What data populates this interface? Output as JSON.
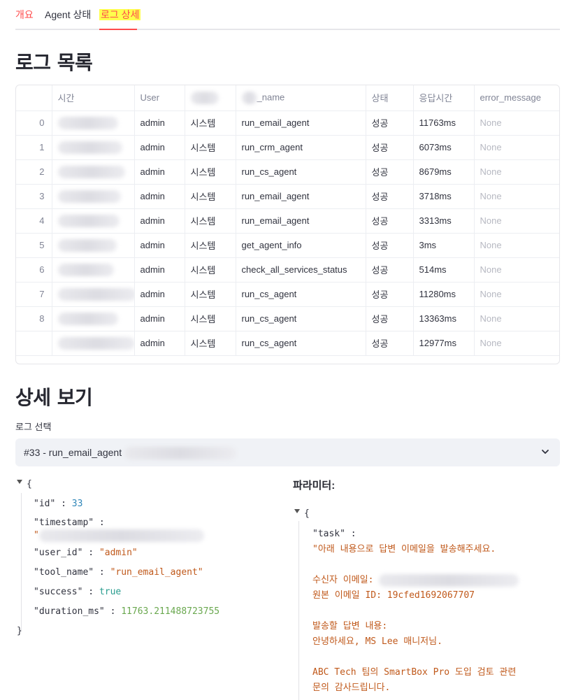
{
  "tabs": [
    {
      "label": "개요"
    },
    {
      "label": "Agent 상태"
    },
    {
      "label": "로그 상세"
    }
  ],
  "log_list": {
    "title": "로그 목록",
    "columns": [
      "",
      "시간",
      "User",
      "",
      "_name",
      "상태",
      "응답시간",
      "error_message"
    ],
    "rows": [
      {
        "idx": "0",
        "user": "admin",
        "type": "시스템",
        "tool": "run_email_agent",
        "status": "성공",
        "duration": "11763ms",
        "error": "None"
      },
      {
        "idx": "1",
        "user": "admin",
        "type": "시스템",
        "tool": "run_crm_agent",
        "status": "성공",
        "duration": "6073ms",
        "error": "None"
      },
      {
        "idx": "2",
        "user": "admin",
        "type": "시스템",
        "tool": "run_cs_agent",
        "status": "성공",
        "duration": "8679ms",
        "error": "None"
      },
      {
        "idx": "3",
        "user": "admin",
        "type": "시스템",
        "tool": "run_email_agent",
        "status": "성공",
        "duration": "3718ms",
        "error": "None"
      },
      {
        "idx": "4",
        "user": "admin",
        "type": "시스템",
        "tool": "run_email_agent",
        "status": "성공",
        "duration": "3313ms",
        "error": "None"
      },
      {
        "idx": "5",
        "user": "admin",
        "type": "시스템",
        "tool": "get_agent_info",
        "status": "성공",
        "duration": "3ms",
        "error": "None"
      },
      {
        "idx": "6",
        "user": "admin",
        "type": "시스템",
        "tool": "check_all_services_status",
        "status": "성공",
        "duration": "514ms",
        "error": "None"
      },
      {
        "idx": "7",
        "user": "admin",
        "type": "시스템",
        "tool": "run_cs_agent",
        "status": "성공",
        "duration": "11280ms",
        "error": "None"
      },
      {
        "idx": "8",
        "user": "admin",
        "type": "시스템",
        "tool": "run_cs_agent",
        "status": "성공",
        "duration": "13363ms",
        "error": "None"
      },
      {
        "idx": "",
        "user": "admin",
        "type": "시스템",
        "tool": "run_cs_agent",
        "status": "성공",
        "duration": "12977ms",
        "error": "None"
      }
    ]
  },
  "detail": {
    "title": "상세 보기",
    "select_label": "로그 선택",
    "select_value": "#33 - run_email_agent"
  },
  "json_view": {
    "open": "{",
    "close": "}",
    "id_key": "\"id\"",
    "id_val": "33",
    "ts_key": "\"timestamp\"",
    "ts_val": "\"",
    "user_key": "\"user_id\"",
    "user_val": "\"admin\"",
    "tool_key": "\"tool_name\"",
    "tool_val": "\"run_email_agent\"",
    "success_key": "\"success\"",
    "success_val": "true",
    "dur_key": "\"duration_ms\"",
    "dur_val": "11763.211488723755"
  },
  "params": {
    "title": "파라미터:",
    "open": "{",
    "task_key": "\"task\"",
    "line1": "\"아래 내용으로 답변 이메일을 발송해주세요.",
    "line2": "수신자 이메일:",
    "line3": "원본 이메일 ID: 19cfed1692067707",
    "line4": "발송할 답변 내용:",
    "line5": "안녕하세요, MS Lee 매니저님.",
    "line6": "ABC Tech 팀의 SmartBox Pro 도입 검토 관련",
    "line7": "문의 감사드립니다."
  }
}
